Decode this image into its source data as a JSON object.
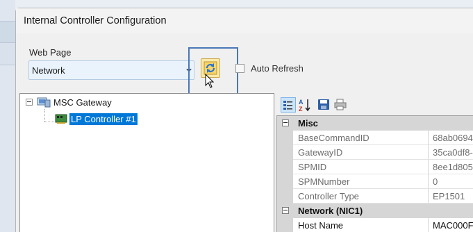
{
  "window": {
    "title": "Internal Controller Configuration"
  },
  "webpage": {
    "label": "Web Page",
    "selected": "Network"
  },
  "auto_refresh": {
    "label": "Auto Refresh",
    "checked": false
  },
  "tree": {
    "root": "MSC Gateway",
    "child": "LP Controller #1"
  },
  "property_grid": {
    "categories": [
      {
        "name": "Misc",
        "rows": [
          {
            "name": "BaseCommandID",
            "value": "68ab0694"
          },
          {
            "name": "GatewayID",
            "value": "35ca0df8-"
          },
          {
            "name": "SPMID",
            "value": "8ee1d805"
          },
          {
            "name": "SPMNumber",
            "value": "0"
          },
          {
            "name": "Controller Type",
            "value": "EP1501"
          }
        ]
      },
      {
        "name": "Network (NIC1)",
        "rows": [
          {
            "name": "Host Name",
            "value": "MAC000F"
          }
        ]
      }
    ]
  },
  "colors": {
    "selection": "#0078d7",
    "highlight_border": "#4a78b8",
    "refresh_button": "#fbe9a6"
  }
}
